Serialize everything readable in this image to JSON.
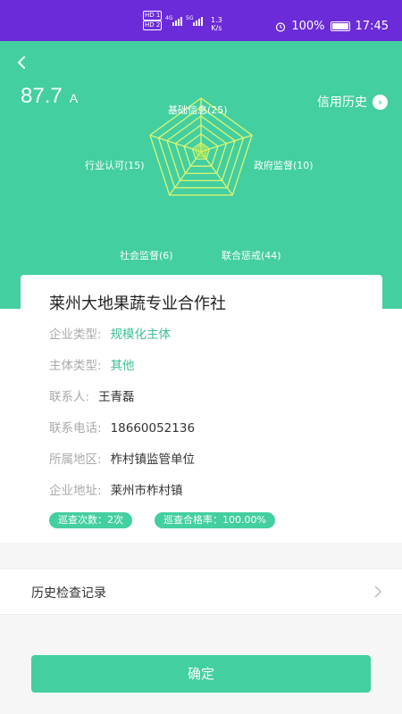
{
  "status_bar": {
    "hd1": "HD 1",
    "hd2": "HD 2",
    "sig1": "4G",
    "sig2": "5G",
    "net_speed": "1.3",
    "net_unit": "K/s",
    "battery": "100%",
    "time": "17:45"
  },
  "header": {
    "score": "87.7",
    "grade": "A",
    "credit_history_label": "信用历史",
    "credit_history_icon": "arrow-right-circle-icon",
    "back_icon": "chevron-left-icon"
  },
  "radar": {
    "labels": {
      "basic_info": "基础信息(25)",
      "gov_supervision": "政府监督(10)",
      "joint_discipline": "联合惩戒(44)",
      "social_supervision": "社会监督(6)",
      "industry_recognition": "行业认可(15)"
    },
    "colors": {
      "grid": "#ddf572",
      "area": "#c8f04a"
    }
  },
  "company": {
    "name": "莱州大地果蔬专业合作社",
    "fields": [
      {
        "label": "企业类型:",
        "value": "规模化主体"
      },
      {
        "label": "主体类型:",
        "value": "其他"
      },
      {
        "label": "联系人:",
        "value": "王青磊"
      },
      {
        "label": "联系电话:",
        "value": "18660052136"
      },
      {
        "label": "所属地区:",
        "value": "柞村镇监管单位"
      },
      {
        "label": "企业地址:",
        "value": "莱州市柞村镇"
      }
    ],
    "tags": {
      "inspections": "巡查次数：2次",
      "pass_rate": "巡查合格率：100.00%"
    }
  },
  "history": {
    "label": "历史检查记录",
    "icon": "chevron-right-icon"
  },
  "confirm_button": "确定",
  "colors": {
    "accent": "#43cfa0",
    "status_bar": "#6c2bd9",
    "accent_text": "#3cbf92"
  }
}
